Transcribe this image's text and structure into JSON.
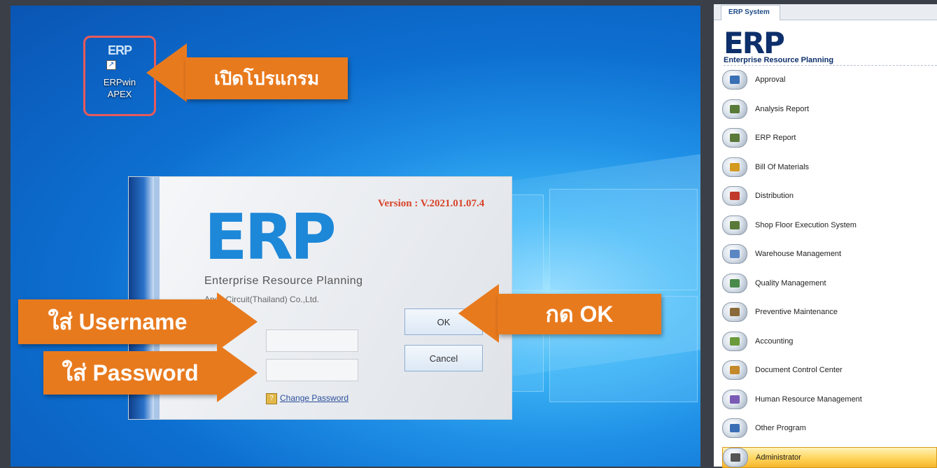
{
  "desktop": {
    "icon": {
      "logo": "ERP",
      "label_line1": "ERPwin",
      "label_line2": "APEX"
    },
    "callouts": {
      "open_program": "เปิดโปรแกรม",
      "enter_username": "ใส่ Username",
      "enter_password": "ใส่ Password",
      "press_ok": "กด OK"
    }
  },
  "login": {
    "logo": "ERP",
    "version": "Version : V.2021.01.07.4",
    "tagline": "Enterprise Resource Planning",
    "company": "Apex Circuit(Thailand) Co.,Ltd.",
    "username_value": "",
    "password_value": "",
    "ok_label": "OK",
    "cancel_label": "Cancel",
    "change_password_label": "Change Password"
  },
  "erp_panel": {
    "tab": "ERP System",
    "logo": "ERP",
    "subtitle": "Enterprise Resource Planning",
    "items": [
      {
        "label": "Approval",
        "icon": "approval-icon",
        "color": "#3a6fb5"
      },
      {
        "label": "Analysis Report",
        "icon": "building-icon",
        "color": "#5a7a3a"
      },
      {
        "label": "ERP Report",
        "icon": "building-icon",
        "color": "#5a7a3a"
      },
      {
        "label": "Bill Of Materials",
        "icon": "gears-icon",
        "color": "#d39a1e"
      },
      {
        "label": "Distribution",
        "icon": "calendar-icon",
        "color": "#c0392b"
      },
      {
        "label": "Shop Floor Execution System",
        "icon": "building-icon",
        "color": "#5a7a3a"
      },
      {
        "label": "Warehouse Management",
        "icon": "truck-icon",
        "color": "#5b86c4"
      },
      {
        "label": "Quality Management",
        "icon": "magnifier-icon",
        "color": "#4a8a4a"
      },
      {
        "label": "Preventive Maintenance",
        "icon": "machine-icon",
        "color": "#8a6a3a"
      },
      {
        "label": "Accounting",
        "icon": "money-bag-icon",
        "color": "#6a9a3a"
      },
      {
        "label": "Document Control Center",
        "icon": "folder-icon",
        "color": "#c4892a"
      },
      {
        "label": "Human Resource Management",
        "icon": "people-icon",
        "color": "#7a5ab5"
      },
      {
        "label": "Other Program",
        "icon": "window-icon",
        "color": "#3a6fb5"
      },
      {
        "label": "Administrator",
        "icon": "admin-user-icon",
        "color": "#555555"
      }
    ],
    "active_item": "Administrator"
  }
}
